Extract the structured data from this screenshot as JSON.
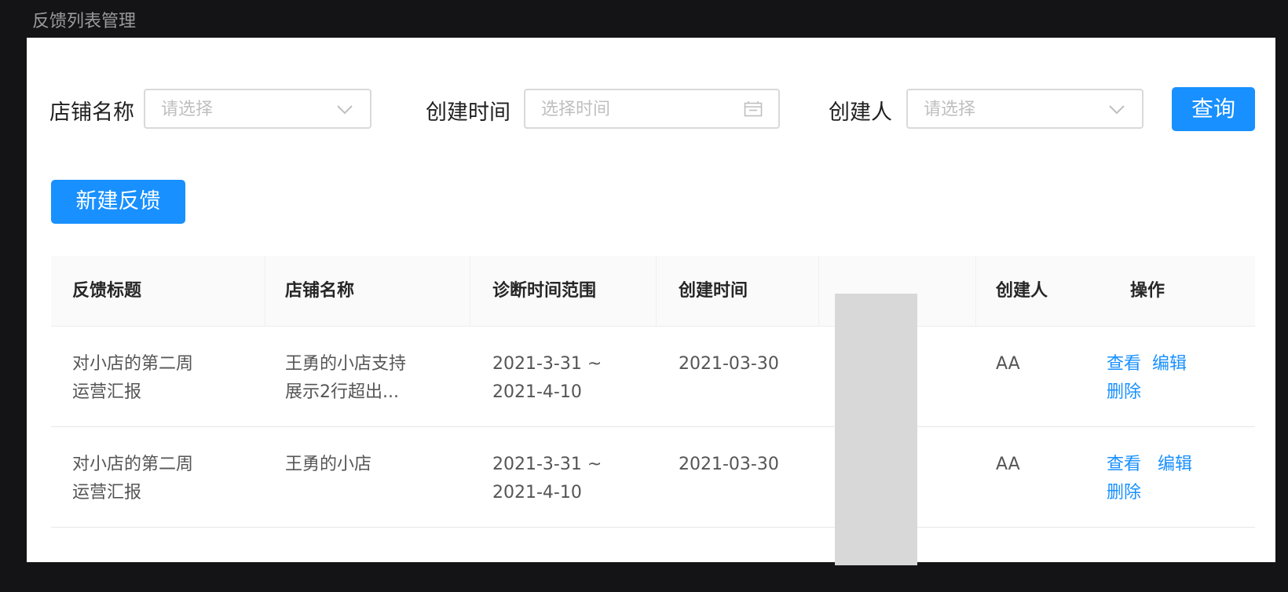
{
  "page": {
    "title": "反馈列表管理"
  },
  "filters": {
    "shop": {
      "label": "店铺名称",
      "placeholder": "请选择"
    },
    "created_time": {
      "label": "创建时间",
      "placeholder": "选择时间"
    },
    "creator": {
      "label": "创建人",
      "placeholder": "请选择"
    },
    "query_label": "查询"
  },
  "actions": {
    "new_label": "新建反馈"
  },
  "table": {
    "columns": [
      "反馈标题",
      "店铺名称",
      "诊断时间范围",
      "创建时间",
      "创建人",
      "操作"
    ],
    "rows": [
      {
        "title": [
          "对小店的第二周",
          "运营汇报"
        ],
        "shop": [
          "王勇的小店支持",
          "展示2行超出..."
        ],
        "range": [
          "2021-3-31 ~",
          "2021-4-10"
        ],
        "created": "2021-03-30",
        "creator": "AA",
        "ops": {
          "view": "查看",
          "edit": "编辑",
          "delete": "删除"
        }
      },
      {
        "title": [
          "对小店的第二周",
          "运营汇报"
        ],
        "shop": [
          "王勇的小店"
        ],
        "range": [
          "2021-3-31 ~",
          "2021-4-10"
        ],
        "created": "2021-03-30",
        "creator": "AA",
        "ops": {
          "view": "查看",
          "edit": "编辑",
          "delete": "删除"
        }
      }
    ]
  },
  "colors": {
    "primary": "#1890ff",
    "background": "#141417",
    "panel": "#ffffff",
    "header_bg": "#fafafa",
    "placeholder": "#bfbfbf",
    "gray_column": "#d8d8d8"
  },
  "icons": {
    "shop_select": "chevron-down-icon",
    "time_picker": "calendar-icon",
    "creator_select": "chevron-down-icon"
  }
}
